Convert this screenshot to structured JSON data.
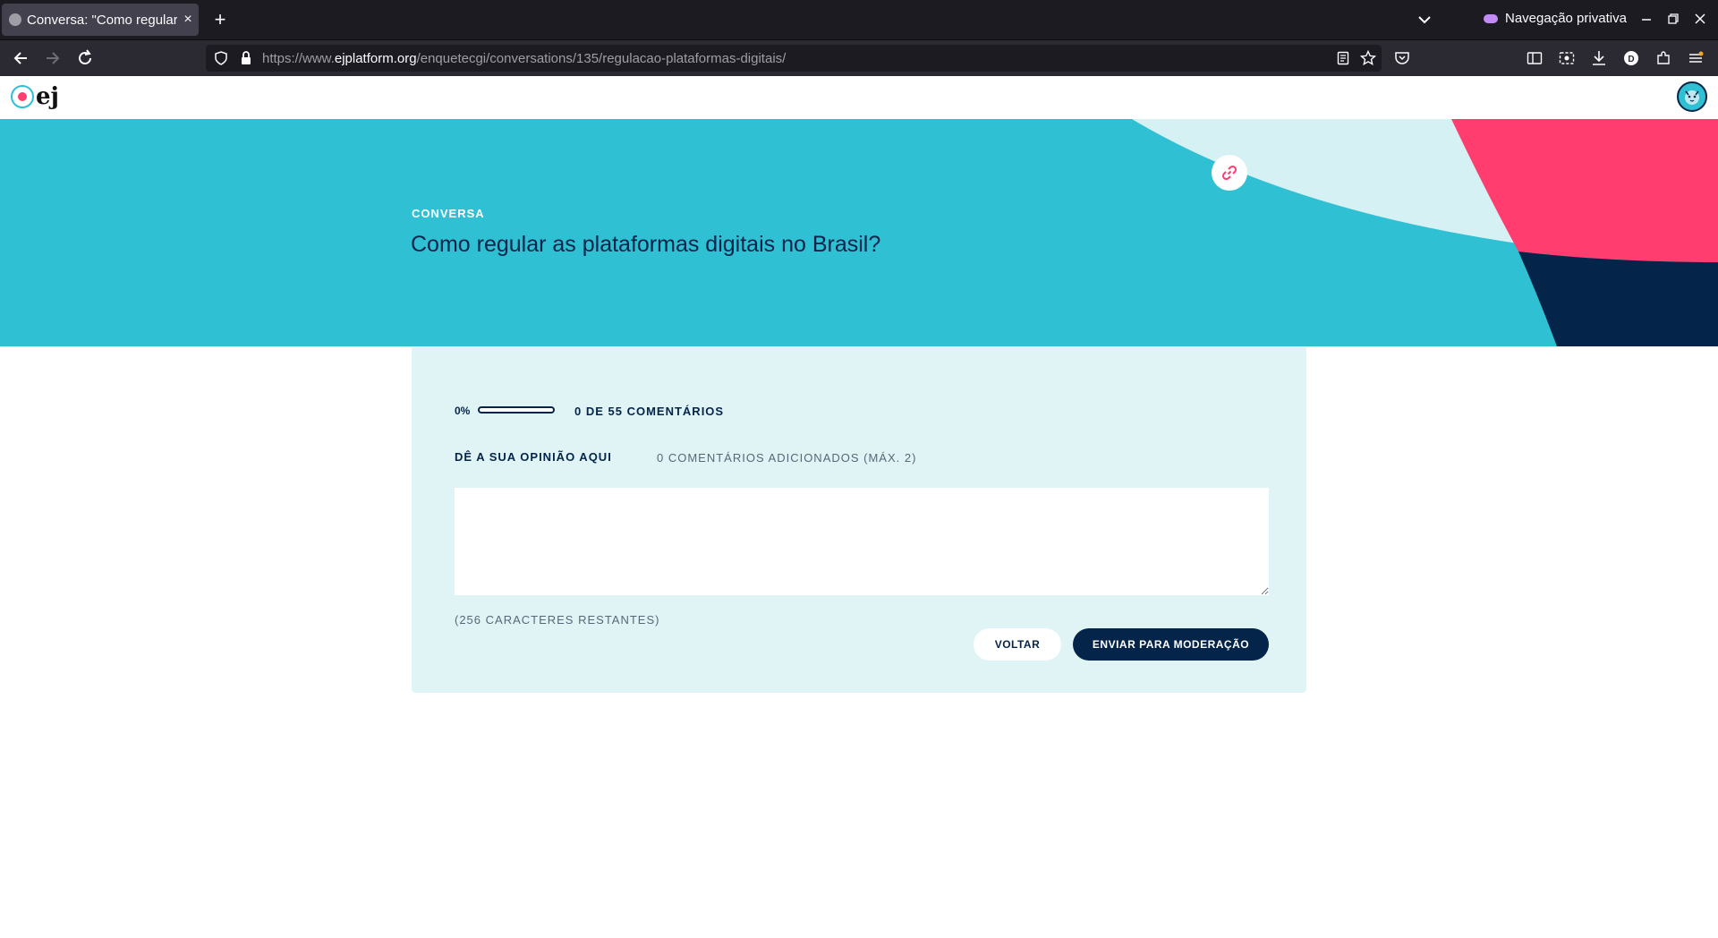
{
  "browser": {
    "tab_title": "Conversa: \"Como regular",
    "tab_close": "×",
    "new_tab": "+",
    "private_label": "Navegação privativa",
    "url_prefix": "https://www.",
    "url_domain": "ejplatform.org",
    "url_path": "/enquetecgi/conversations/135/regulacao-plataformas-digitais/"
  },
  "site": {
    "logo_text": "ej"
  },
  "banner": {
    "eyebrow": "CONVERSA",
    "title": "Como regular as plataformas digitais no Brasil?",
    "colors": {
      "teal": "#30c0d4",
      "light": "#d6f1f4",
      "pink": "#ff3d6e",
      "navy": "#052449"
    }
  },
  "panel": {
    "progress_pct_label": "0%",
    "progress_value": 0,
    "progress_text": "0 DE 55 COMENTÁRIOS",
    "opinion_label": "DÊ A SUA OPINIÃO AQUI",
    "added_count": "0 COMENTÁRIOS ADICIONADOS (MÁX. 2)",
    "comment_value": "",
    "chars_left": "(256 CARACTERES RESTANTES)",
    "back_label": "VOLTAR",
    "send_label": "ENVIAR PARA MODERAÇÃO"
  }
}
